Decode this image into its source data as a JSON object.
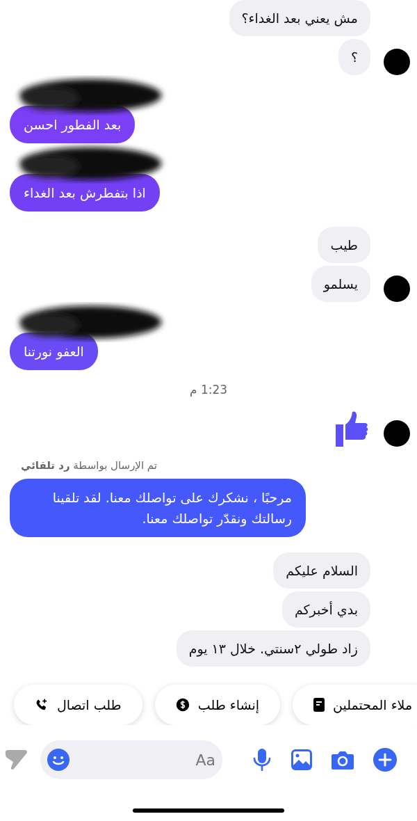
{
  "messages": [
    {
      "kind": "incoming",
      "text": "مش يعني بعد الغداء؟",
      "avatar": false
    },
    {
      "kind": "incoming",
      "text": "؟",
      "avatar": true
    },
    {
      "kind": "redacted"
    },
    {
      "kind": "outgoing",
      "text": "بعد الفطور احسن",
      "color": "#7a3ff6"
    },
    {
      "kind": "redacted"
    },
    {
      "kind": "outgoing",
      "text": "اذا بتفطرش بعد الغداء",
      "color": "#7440f6"
    },
    {
      "kind": "incoming",
      "text": "طيب",
      "avatar": false
    },
    {
      "kind": "incoming",
      "text": "يسلمو",
      "avatar": true
    },
    {
      "kind": "redacted"
    },
    {
      "kind": "outgoing",
      "text": "العفو نورتنا",
      "color": "#6a4cf7"
    },
    {
      "kind": "timestamp",
      "text": "1:23 م"
    },
    {
      "kind": "like",
      "avatar": true
    },
    {
      "kind": "note",
      "text": "تم الإرسال بواسطة **رد تلقائي**"
    },
    {
      "kind": "outgoing",
      "text": "مرحبًا ، نشكرك على تواصلك معنا. لقد تلقينا رسالتك ونقدّر تواصلك معنا.",
      "color": "#4458fb"
    },
    {
      "kind": "incoming",
      "text": "السلام عليكم",
      "avatar": false
    },
    {
      "kind": "incoming",
      "text": "بدي أخبركم",
      "avatar": false
    },
    {
      "kind": "incoming",
      "text": "زاد طولي ٢سنتي. خلال ١٣ يوم",
      "avatar": false
    }
  ],
  "quick_replies": [
    {
      "kind": "leads",
      "label": "ملاء المحتملين"
    },
    {
      "kind": "order",
      "label": "إنشاء طلب"
    },
    {
      "kind": "call",
      "label": "طلب اتصال"
    }
  ],
  "composer": {
    "placeholder": "Aa"
  }
}
